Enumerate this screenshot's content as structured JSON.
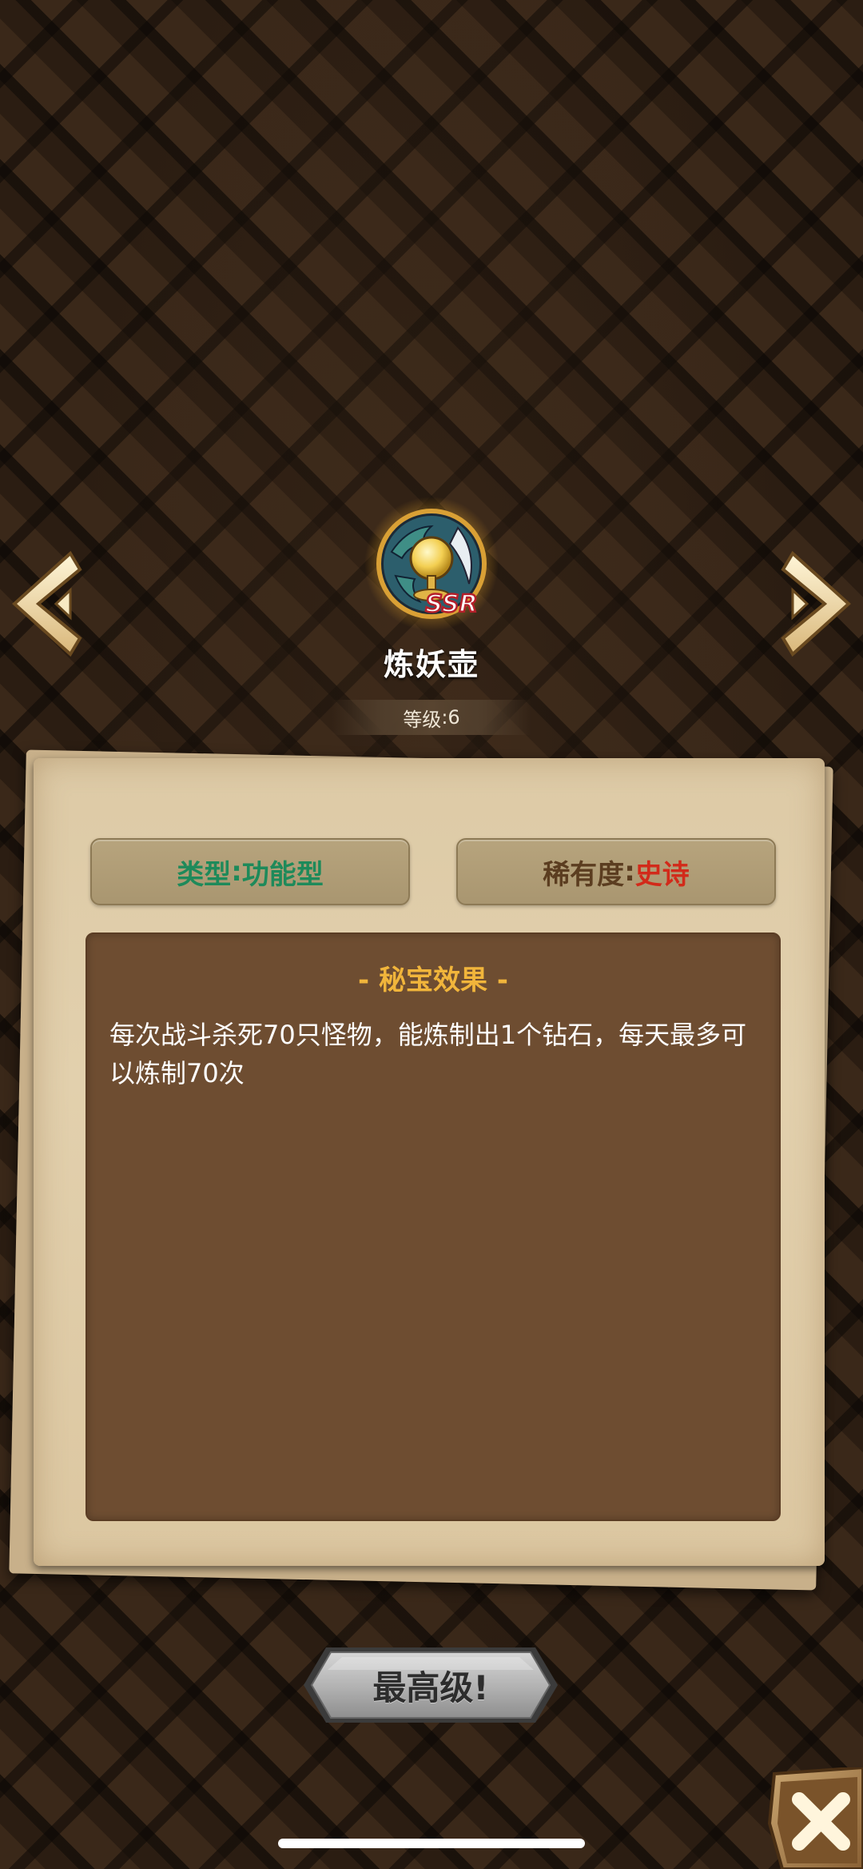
{
  "item": {
    "name": "炼妖壶",
    "badge": "SSR",
    "level_label": "等级",
    "level_separator": ": ",
    "level_value": "6"
  },
  "tags": {
    "type_label": "类型",
    "type_separator": ":",
    "type_value": "功能型",
    "rarity_label": "稀有度",
    "rarity_separator": ":",
    "rarity_value": "史诗"
  },
  "effect": {
    "title": "- 秘宝效果 -",
    "description": "每次战斗杀死70只怪物，能炼制出1个钻石，每天最多可以炼制70次"
  },
  "buttons": {
    "max_level_label": "最高级!",
    "prev_icon": "chevron-left-icon",
    "next_icon": "chevron-right-icon",
    "close_icon": "close-icon"
  },
  "colors": {
    "type_value": "#1e8a5a",
    "rarity_value": "#d22a1a",
    "effect_title": "#f1b53b",
    "panel": "#6e4d31",
    "parchment": "#e2d0ad"
  }
}
